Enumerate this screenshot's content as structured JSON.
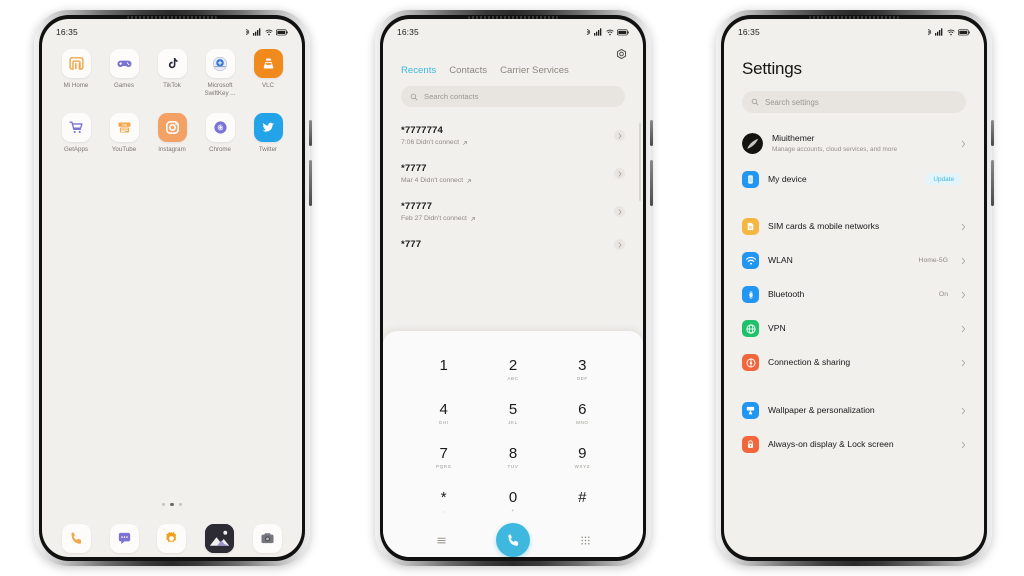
{
  "phones": {
    "home": {
      "name": "home-screen",
      "status_bar": {
        "time": "16:35",
        "icons": [
          "bluetooth-icon",
          "signal-icon",
          "wifi-icon",
          "battery-icon"
        ]
      },
      "apps_row1": [
        {
          "label": "Mi Home",
          "icon": "mi-home-icon",
          "color": "#f0a84a"
        },
        {
          "label": "Games",
          "icon": "games-controller-icon",
          "color": "#7b72d6"
        },
        {
          "label": "TikTok",
          "icon": "tiktok-icon",
          "color": "#2b2b38"
        },
        {
          "label": "Microsoft SwiftKey ...",
          "icon": "swiftkey-icon",
          "color": "#2d6fd6"
        },
        {
          "label": "VLC",
          "icon": "vlc-cone-icon",
          "color": "#f08a1c"
        }
      ],
      "apps_row2": [
        {
          "label": "GetApps",
          "icon": "getapps-cart-icon",
          "color": "#7b72d6"
        },
        {
          "label": "YouTube",
          "icon": "youtube-icon",
          "color": "#f0a84a"
        },
        {
          "label": "Instagram",
          "icon": "instagram-icon",
          "color": "#f0a060"
        },
        {
          "label": "Chrome",
          "icon": "chrome-icon",
          "color": "#7b72d6"
        },
        {
          "label": "Twitter",
          "icon": "twitter-bird-icon",
          "color": "#23a4e8"
        }
      ],
      "page_dots": {
        "count": 3,
        "active_index": 1
      },
      "dock": [
        {
          "label": "Phone",
          "icon": "phone-handset-icon",
          "color": "#f0a84a"
        },
        {
          "label": "Messages",
          "icon": "message-bubble-icon",
          "color": "#7b72d6"
        },
        {
          "label": "Settings",
          "icon": "gear-icon",
          "color": "#f0a018"
        },
        {
          "label": "Gallery",
          "icon": "gallery-picture-icon",
          "color": "#2b2b38"
        },
        {
          "label": "Camera",
          "icon": "camera-icon",
          "color": "#6b6b70"
        }
      ]
    },
    "dialer": {
      "name": "phone-dialer-screen",
      "status_bar": {
        "time": "16:35",
        "icons": [
          "bluetooth-icon",
          "signal-icon",
          "wifi-icon",
          "battery-icon"
        ]
      },
      "settings_icon": "settings-gear-icon",
      "tabs": [
        {
          "label": "Recents",
          "active": true
        },
        {
          "label": "Contacts",
          "active": false
        },
        {
          "label": "Carrier Services",
          "active": false
        }
      ],
      "search": {
        "placeholder": "Search contacts",
        "icon": "search-icon"
      },
      "call_log": [
        {
          "number": "*7777774",
          "detail": "7:06 Didn't connect"
        },
        {
          "number": "*7777",
          "detail": "Mar 4 Didn't connect"
        },
        {
          "number": "*77777",
          "detail": "Feb 27 Didn't connect"
        },
        {
          "number": "*777",
          "detail": ""
        }
      ],
      "keypad": [
        {
          "digit": "1",
          "sub": ""
        },
        {
          "digit": "2",
          "sub": "ABC"
        },
        {
          "digit": "3",
          "sub": "DEF"
        },
        {
          "digit": "4",
          "sub": "GHI"
        },
        {
          "digit": "5",
          "sub": "JKL"
        },
        {
          "digit": "6",
          "sub": "MNO"
        },
        {
          "digit": "7",
          "sub": "PQRS"
        },
        {
          "digit": "8",
          "sub": "TUV"
        },
        {
          "digit": "9",
          "sub": "WXYZ"
        },
        {
          "digit": "*",
          "sub": ","
        },
        {
          "digit": "0",
          "sub": "+"
        },
        {
          "digit": "#",
          "sub": ""
        }
      ],
      "bottom_bar": {
        "menu_icon": "menu-lines-icon",
        "call_icon": "call-handset-icon",
        "call_color": "#3fb8e0",
        "keypad_icon": "keypad-grid-icon"
      }
    },
    "settings": {
      "name": "settings-screen",
      "status_bar": {
        "time": "16:35",
        "icons": [
          "bluetooth-icon",
          "signal-icon",
          "wifi-icon",
          "battery-icon"
        ]
      },
      "title": "Settings",
      "search": {
        "placeholder": "Search settings",
        "icon": "search-icon"
      },
      "account": {
        "name": "Miuithemer",
        "subtitle": "Manage accounts, cloud services, and more",
        "avatar": "user-avatar"
      },
      "device": {
        "label": "My device",
        "badge": "Update",
        "icon": "device-phone-icon",
        "color": "#2196f3"
      },
      "rows": [
        {
          "label": "SIM cards & mobile networks",
          "value": "",
          "icon": "sim-card-icon",
          "color": "#f5b642",
          "group": 1
        },
        {
          "label": "WLAN",
          "value": "Home-5G",
          "icon": "wifi-icon",
          "color": "#2196f3",
          "group": 1
        },
        {
          "label": "Bluetooth",
          "value": "On",
          "icon": "bluetooth-icon",
          "color": "#2196f3",
          "group": 1
        },
        {
          "label": "VPN",
          "value": "",
          "icon": "globe-icon",
          "color": "#1fc16b",
          "group": 1
        },
        {
          "label": "Connection & sharing",
          "value": "",
          "icon": "share-connect-icon",
          "color": "#f2663c",
          "group": 1
        },
        {
          "label": "Wallpaper & personalization",
          "value": "",
          "icon": "wallpaper-brush-icon",
          "color": "#2196f3",
          "group": 2
        },
        {
          "label": "Always-on display & Lock screen",
          "value": "",
          "icon": "lock-icon",
          "color": "#f2663c",
          "group": 2
        }
      ],
      "chevron_icon": "chevron-right-icon"
    }
  }
}
